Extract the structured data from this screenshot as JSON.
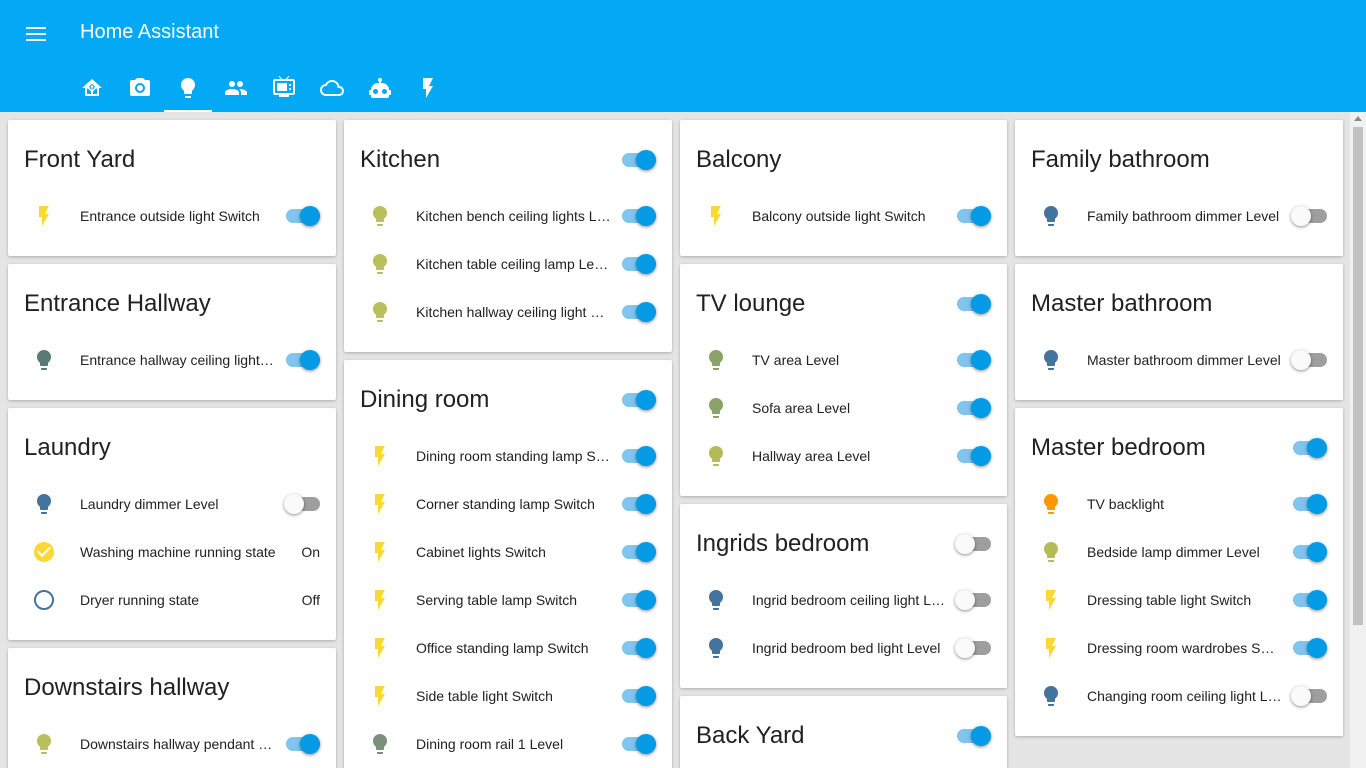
{
  "app": {
    "title": "Home Assistant"
  },
  "tabs": [
    {
      "icon": "home-assistant-icon"
    },
    {
      "icon": "camera-icon"
    },
    {
      "icon": "lightbulb-icon",
      "active": true
    },
    {
      "icon": "account-group-icon"
    },
    {
      "icon": "television-icon"
    },
    {
      "icon": "cloud-icon"
    },
    {
      "icon": "robot-icon"
    },
    {
      "icon": "flash-icon"
    }
  ],
  "colors": {
    "header": "#03a9f4",
    "toggle_on": "#039be5",
    "bolt_yellow": "#fdd835",
    "bulb_olive": "#b9c05a",
    "bulb_dim": "#7a9a5a",
    "bulb_blue": "#44739e",
    "bulb_orange": "#ff9800"
  },
  "cards": {
    "front_yard": {
      "title": "Front Yard",
      "rows": [
        {
          "label": "Entrance outside light Switch",
          "icon": "flash-icon",
          "state": "on"
        }
      ]
    },
    "entrance_hallway": {
      "title": "Entrance Hallway",
      "rows": [
        {
          "label": "Entrance hallway ceiling light Level",
          "icon": "lightbulb-icon",
          "state": "on"
        }
      ]
    },
    "laundry": {
      "title": "Laundry",
      "rows": [
        {
          "label": "Laundry dimmer Level",
          "icon": "lightbulb-icon",
          "state": "off"
        },
        {
          "label": "Washing machine running state",
          "icon": "check-circle-icon",
          "value": "On"
        },
        {
          "label": "Dryer running state",
          "icon": "circle-outline-icon",
          "value": "Off"
        }
      ]
    },
    "downstairs_hallway": {
      "title": "Downstairs hallway",
      "rows": [
        {
          "label": "Downstairs hallway pendant Level",
          "icon": "lightbulb-icon",
          "state": "on"
        }
      ]
    },
    "kitchen": {
      "title": "Kitchen",
      "header_state": "on",
      "rows": [
        {
          "label": "Kitchen bench ceiling lights Level",
          "icon": "lightbulb-icon",
          "state": "on"
        },
        {
          "label": "Kitchen table ceiling lamp Level",
          "icon": "lightbulb-icon",
          "state": "on"
        },
        {
          "label": "Kitchen hallway ceiling light Level",
          "icon": "lightbulb-icon",
          "state": "on"
        }
      ]
    },
    "dining_room": {
      "title": "Dining room",
      "header_state": "on",
      "rows": [
        {
          "label": "Dining room standing lamp Switch",
          "icon": "flash-icon",
          "state": "on"
        },
        {
          "label": "Corner standing lamp Switch",
          "icon": "flash-icon",
          "state": "on"
        },
        {
          "label": "Cabinet lights Switch",
          "icon": "flash-icon",
          "state": "on"
        },
        {
          "label": "Serving table lamp Switch",
          "icon": "flash-icon",
          "state": "on"
        },
        {
          "label": "Office standing lamp Switch",
          "icon": "flash-icon",
          "state": "on"
        },
        {
          "label": "Side table light Switch",
          "icon": "flash-icon",
          "state": "on"
        },
        {
          "label": "Dining room rail 1 Level",
          "icon": "lightbulb-icon",
          "state": "on"
        }
      ]
    },
    "balcony": {
      "title": "Balcony",
      "rows": [
        {
          "label": "Balcony outside light Switch",
          "icon": "flash-icon",
          "state": "on"
        }
      ]
    },
    "tv_lounge": {
      "title": "TV lounge",
      "header_state": "on",
      "rows": [
        {
          "label": "TV area Level",
          "icon": "lightbulb-icon",
          "state": "on"
        },
        {
          "label": "Sofa area Level",
          "icon": "lightbulb-icon",
          "state": "on"
        },
        {
          "label": "Hallway area Level",
          "icon": "lightbulb-icon",
          "state": "on"
        }
      ]
    },
    "ingrids_bedroom": {
      "title": "Ingrids bedroom",
      "header_state": "off",
      "rows": [
        {
          "label": "Ingrid bedroom ceiling light Level",
          "icon": "lightbulb-icon",
          "state": "off"
        },
        {
          "label": "Ingrid bedroom bed light Level",
          "icon": "lightbulb-icon",
          "state": "off"
        }
      ]
    },
    "back_yard": {
      "title": "Back Yard",
      "header_state": "on"
    },
    "family_bathroom": {
      "title": "Family bathroom",
      "rows": [
        {
          "label": "Family bathroom dimmer Level",
          "icon": "lightbulb-icon",
          "state": "off"
        }
      ]
    },
    "master_bathroom": {
      "title": "Master bathroom",
      "rows": [
        {
          "label": "Master bathroom dimmer Level",
          "icon": "lightbulb-icon",
          "state": "off"
        }
      ]
    },
    "master_bedroom": {
      "title": "Master bedroom",
      "header_state": "on",
      "rows": [
        {
          "label": "TV backlight",
          "icon": "lightbulb-icon",
          "state": "on"
        },
        {
          "label": "Bedside lamp dimmer Level",
          "icon": "lightbulb-icon",
          "state": "on"
        },
        {
          "label": "Dressing table light Switch",
          "icon": "flash-icon",
          "state": "on"
        },
        {
          "label": "Dressing room wardrobes Switch",
          "icon": "flash-icon",
          "state": "on"
        },
        {
          "label": "Changing room ceiling light Level",
          "icon": "lightbulb-icon",
          "state": "off"
        }
      ]
    }
  }
}
